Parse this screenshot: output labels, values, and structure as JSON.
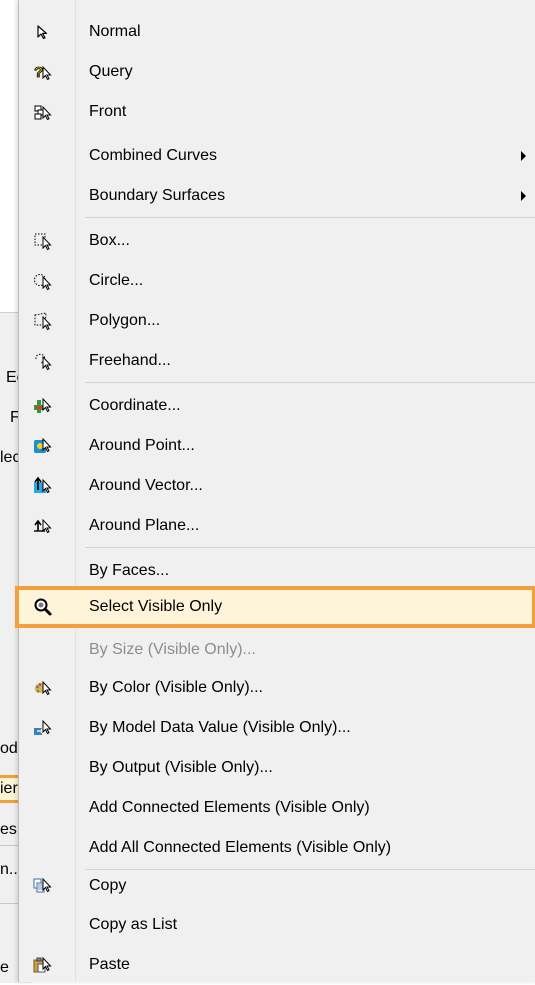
{
  "parent_menu": {
    "items": [
      "Ec",
      "Fa",
      "lec",
      "od",
      "ier",
      "es",
      "n..",
      "e"
    ]
  },
  "menu": {
    "items": [
      {
        "label": "Normal",
        "icon": "arrow-pointer-icon"
      },
      {
        "label": "Query",
        "icon": "query-icon"
      },
      {
        "label": "Front",
        "icon": "front-icon"
      },
      {
        "label": "Combined Curves",
        "submenu": true
      },
      {
        "label": "Boundary Surfaces",
        "submenu": true
      },
      {
        "label": "Box...",
        "icon": "box-select-icon"
      },
      {
        "label": "Circle...",
        "icon": "circle-select-icon"
      },
      {
        "label": "Polygon...",
        "icon": "polygon-select-icon"
      },
      {
        "label": "Freehand...",
        "icon": "freehand-select-icon"
      },
      {
        "label": "Coordinate...",
        "icon": "coordinate-icon"
      },
      {
        "label": "Around Point...",
        "icon": "around-point-icon"
      },
      {
        "label": "Around Vector...",
        "icon": "around-vector-icon"
      },
      {
        "label": "Around Plane...",
        "icon": "around-plane-icon"
      },
      {
        "label": "By Faces..."
      },
      {
        "label": "Select Visible Only",
        "icon": "magnifier-icon",
        "selected": true
      },
      {
        "label": "By Size (Visible Only)...",
        "disabled": true
      },
      {
        "label": "By Color (Visible Only)...",
        "icon": "palette-icon"
      },
      {
        "label": "By Model Data Value (Visible Only)...",
        "icon": "model-data-icon"
      },
      {
        "label": "By Output (Visible Only)..."
      },
      {
        "label": "Add Connected Elements (Visible Only)"
      },
      {
        "label": "Add All Connected Elements (Visible Only)"
      },
      {
        "label": "Copy",
        "icon": "copy-icon"
      },
      {
        "label": "Copy as List"
      },
      {
        "label": "Paste",
        "icon": "paste-icon"
      }
    ]
  },
  "colors": {
    "menu_bg": "#f0f0f0",
    "highlight_border": "#f2a03d",
    "highlight_bg": "#fdf4da",
    "disabled_text": "#8d8d8d"
  }
}
